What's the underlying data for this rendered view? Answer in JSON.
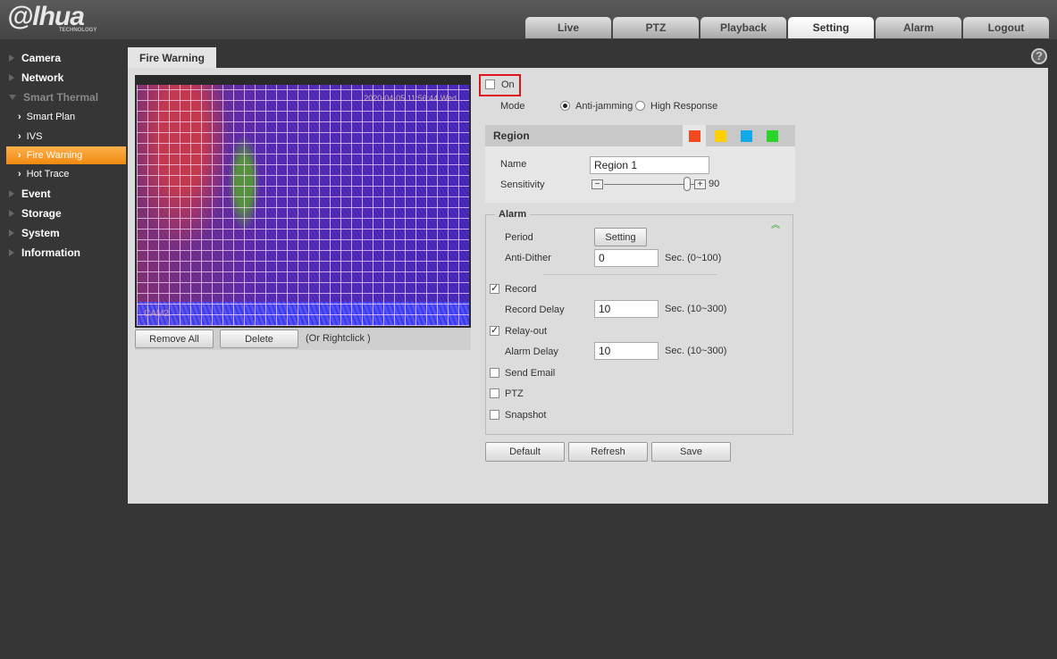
{
  "brand": {
    "logo": "alhua",
    "sub": "TECHNOLOGY"
  },
  "topnav": [
    {
      "label": "Live"
    },
    {
      "label": "PTZ"
    },
    {
      "label": "Playback"
    },
    {
      "label": "Setting",
      "active": true
    },
    {
      "label": "Alarm"
    },
    {
      "label": "Logout"
    }
  ],
  "sidebar": {
    "camera": "Camera",
    "network": "Network",
    "smart_thermal": "Smart Thermal",
    "smart_plan": "Smart Plan",
    "ivs": "IVS",
    "fire_warning": "Fire Warning",
    "hot_trace": "Hot Trace",
    "event": "Event",
    "storage": "Storage",
    "system": "System",
    "information": "Information"
  },
  "help": "?",
  "panel_tab": "Fire Warning",
  "video": {
    "timestamp": "2020-04-05 11:56:44 Wed",
    "channel": "CAM2"
  },
  "video_buttons": {
    "remove_all": "Remove All",
    "delete": "Delete",
    "hint": "(Or Rightclick )"
  },
  "enable": {
    "label": "On",
    "checked": false
  },
  "mode": {
    "label": "Mode",
    "options": [
      "Anti-jamming",
      "High Response"
    ],
    "selected": "Anti-jamming"
  },
  "region": {
    "title": "Region",
    "colors": [
      "#f04a1e",
      "#ffd000",
      "#10a8e8",
      "#2ad42a"
    ],
    "name_label": "Name",
    "name_value": "Region 1",
    "sensitivity_label": "Sensitivity",
    "sensitivity": 90,
    "minus": "−",
    "plus": "+"
  },
  "alarm": {
    "legend": "Alarm",
    "period_label": "Period",
    "period_button": "Setting",
    "anti_dither_label": "Anti-Dither",
    "anti_dither": "0",
    "anti_dither_range": "Sec. (0~100)",
    "record_label": "Record",
    "record": true,
    "record_delay_label": "Record Delay",
    "record_delay": "10",
    "record_delay_range": "Sec. (10~300)",
    "relay_label": "Relay-out",
    "relay": true,
    "alarm_delay_label": "Alarm Delay",
    "alarm_delay": "10",
    "alarm_delay_range": "Sec. (10~300)",
    "email_label": "Send Email",
    "email": false,
    "ptz_label": "PTZ",
    "ptz": false,
    "snapshot_label": "Snapshot",
    "snapshot": false,
    "collapse": "︽"
  },
  "actions": {
    "default": "Default",
    "refresh": "Refresh",
    "save": "Save"
  }
}
